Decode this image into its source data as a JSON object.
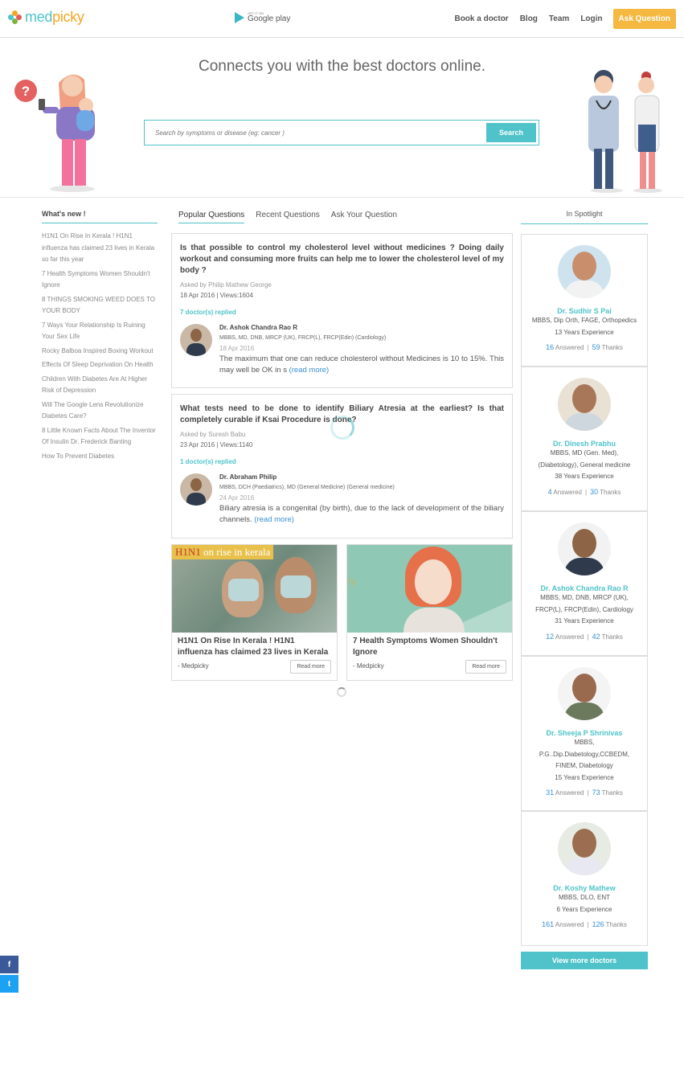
{
  "header": {
    "logo_prefix": "med",
    "logo_suffix": "picky",
    "gplay_small": "GET IT ON",
    "gplay_big": "Google play",
    "nav": {
      "book": "Book a doctor",
      "blog": "Blog",
      "team": "Team",
      "login": "Login",
      "ask": "Ask Question"
    }
  },
  "hero": {
    "title": "Connects you with the best doctors online.",
    "search_placeholder": "Search by symptoms or disease (eg: cancer )",
    "search_button": "Search"
  },
  "news": {
    "title": "What's new !",
    "items": [
      "H1N1 On Rise In Kerala ! H1N1 influenza has claimed 23 lives in Kerala so far this year",
      "7 Health Symptoms Women Shouldn't Ignore",
      "8 THINGS SMOKING WEED DOES TO YOUR BODY",
      "7 Ways Your Relationship Is Ruining Your Sex Life",
      "Rocky Balboa Inspired Boxing Workout",
      "Effects Of Sleep Deprivation On Health",
      "Children With Diabetes Are At Higher Risk of Depression",
      "Will The Google Lens Revolutionize Diabetes Care?",
      "8 Little Known Facts About The Inventor Of Insulin Dr. Frederick Banting",
      "How To Prevent Diabetes"
    ]
  },
  "tabs": [
    "Popular Questions",
    "Recent Questions",
    "Ask Your Question"
  ],
  "questions": [
    {
      "title": "Is that possible to control my cholesterol level without medicines ? Doing daily workout and consuming more fruits can help me to lower the cholesterol level of my body ?",
      "asked_by": "Asked by Philip Mathew George",
      "date_views": "18 Apr 2016 | Views:1604",
      "replied": "7 doctor(s) replied",
      "answer": {
        "name": "Dr. Ashok Chandra Rao R",
        "qual": "MBBS, MD, DNB, MRCP (UK), FRCP(L), FRCP(Edin) (Cardiology)",
        "date": "18 Apr 2016",
        "text": "The maximum that one can reduce cholesterol without Medicines is 10 to 15%. This may well be OK in s",
        "read_more": "(read more)"
      }
    },
    {
      "title": "What tests need to be done to identify Biliary Atresia at the earliest? Is that completely curable if Ksai Procedure is done?",
      "asked_by": "Asked by Suresh Babu",
      "date_views": "23 Apr 2016 | Views:1140",
      "replied": "1 doctor(s) replied",
      "answer": {
        "name": "Dr. Abraham Philip",
        "qual": "MBBS, DCH (Paediatrics), MD (General Medicine) (General medicine)",
        "date": "24 Apr 2016",
        "text": "Biliary atresia is a congenital (by birth), due to the lack of development of the biliary channels.",
        "read_more": "(read more)"
      }
    }
  ],
  "articles": [
    {
      "banner_h1": "H1N1",
      "banner_rest": " on rise in kerala",
      "title": "H1N1 On Rise In Kerala ! H1N1 influenza has claimed 23 lives in Kerala",
      "source": "- Medpicky",
      "read_more": "Read more"
    },
    {
      "watermark": "medpicky",
      "title": "7 Health Symptoms Women Shouldn't Ignore",
      "source": "- Medpicky",
      "read_more": "Read more"
    }
  ],
  "spotlight": {
    "title": "In Spotlight",
    "doctors": [
      {
        "name": "Dr. Sudhir S Pai",
        "info": "MBBS, Dip Orth, FAGE, Orthopedics",
        "exp": "13 Years Experience",
        "answered": "16",
        "thanks": "59"
      },
      {
        "name": "Dr. Dinesh Prabhu",
        "info": "MBBS, MD (Gen. Med), (Diabetology), General medicine",
        "exp": "38 Years Experience",
        "answered": "4",
        "thanks": "30"
      },
      {
        "name": "Dr. Ashok Chandra Rao R",
        "info": "MBBS, MD, DNB, MRCP (UK), FRCP(L), FRCP(Edin), Cardiology",
        "exp": "31 Years Experience",
        "answered": "12",
        "thanks": "42"
      },
      {
        "name": "Dr. Sheeja P Shrinivas",
        "info": "MBBS, P.G..Dip.Diabetology,CCBEDM, FINEM, Diabetology",
        "exp": "15 Years Experience",
        "answered": "31",
        "thanks": "73"
      },
      {
        "name": "Dr. Koshy Mathew",
        "info": "MBBS, DLO, ENT",
        "exp": "6 Years Experience",
        "answered": "161",
        "thanks": "126"
      }
    ],
    "answered_label": "Answered",
    "thanks_label": "Thanks",
    "view_more": "View more doctors"
  },
  "social": {
    "fb": "f",
    "tw": "t"
  },
  "colors": {
    "accent": "#4fc3c9",
    "ask_button": "#f5b840",
    "link": "#3a8fd1"
  }
}
